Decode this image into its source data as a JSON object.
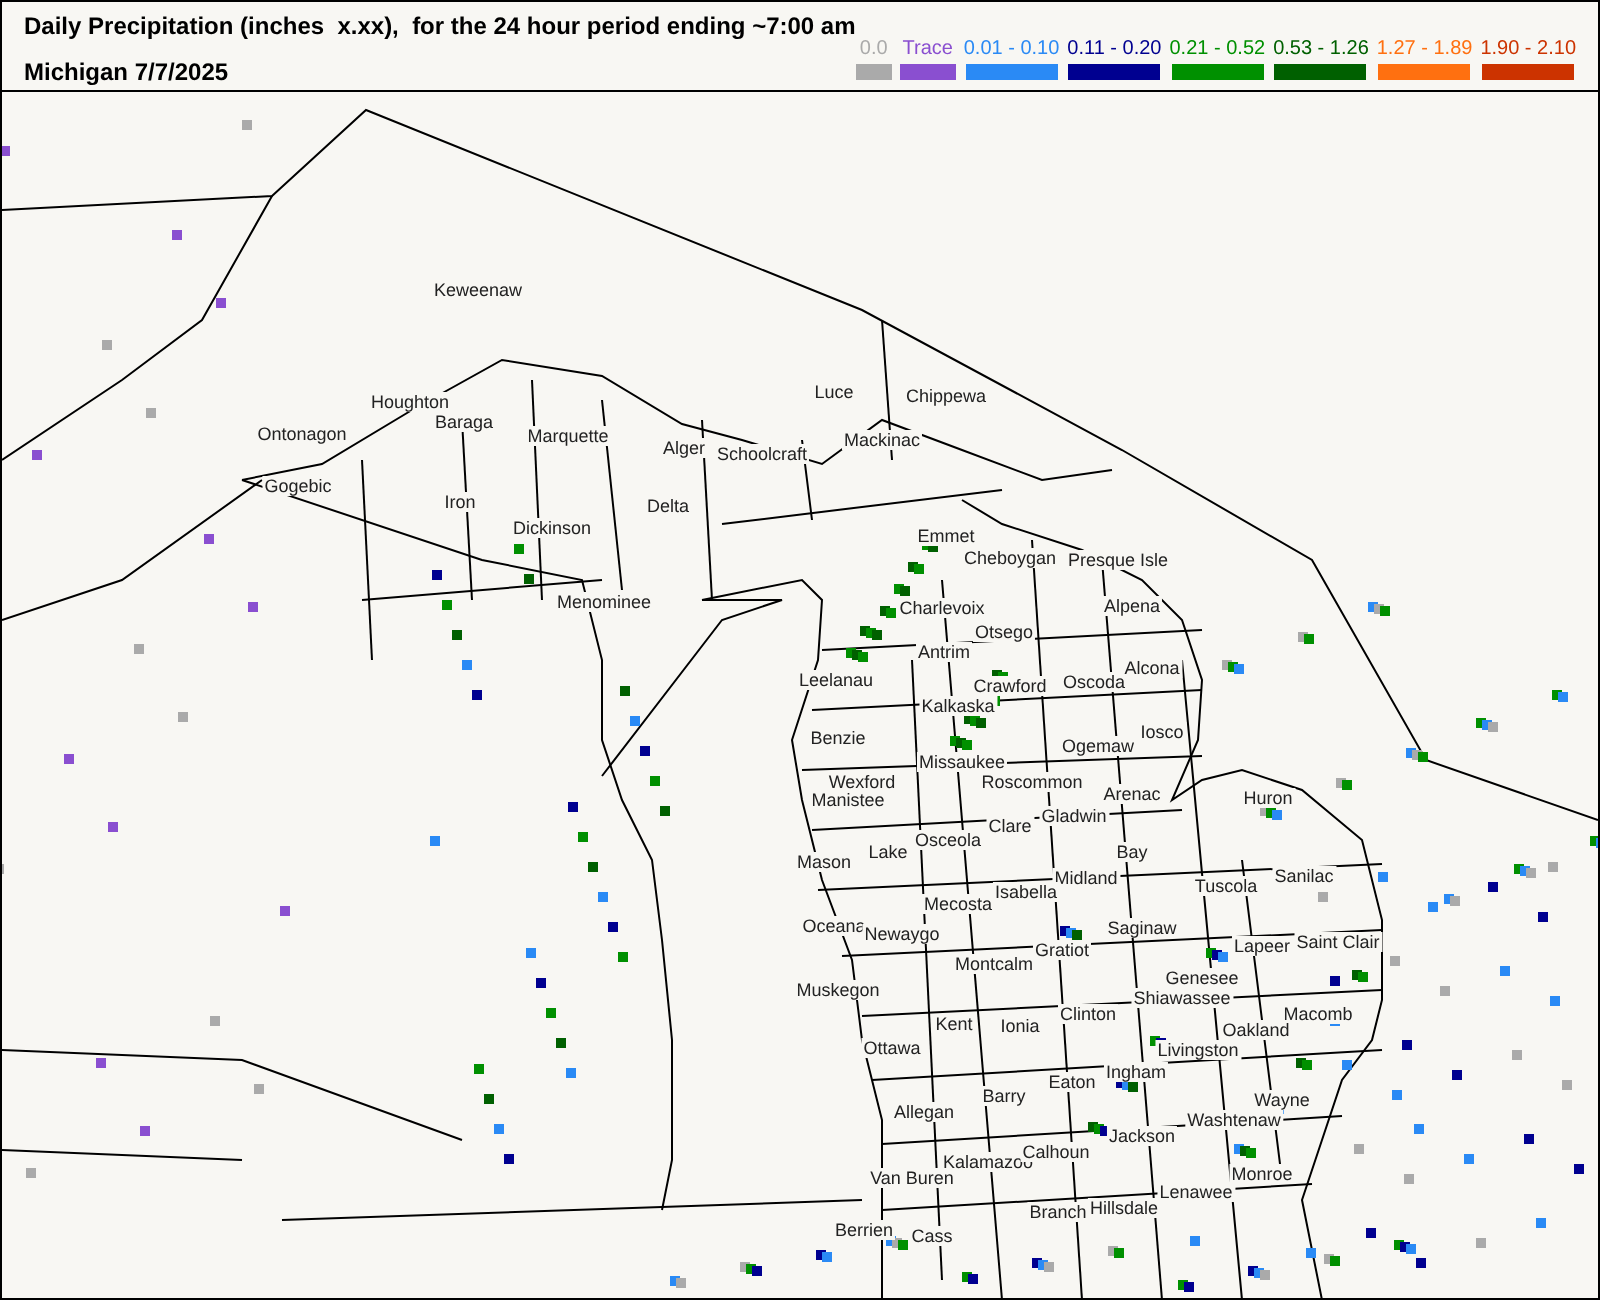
{
  "header": {
    "title": "Daily Precipitation (inches  x.xx),  for the 24 hour period ending ~7:00 am",
    "subtitle": "Michigan 7/7/2025"
  },
  "legend": [
    {
      "label": "0.0",
      "color": "#aaaaaa"
    },
    {
      "label": "Trace",
      "color": "#8a4fd0"
    },
    {
      "label": "0.01 - 0.10",
      "color": "#2a8af5"
    },
    {
      "label": "0.11 - 0.20",
      "color": "#000090"
    },
    {
      "label": "0.21 - 0.52",
      "color": "#009000"
    },
    {
      "label": "0.53 - 1.26",
      "color": "#006000"
    },
    {
      "label": "1.27 - 1.89",
      "color": "#ff7010"
    },
    {
      "label": "1.90 - 2.10",
      "color": "#cc3300"
    }
  ],
  "map": {
    "counties": [
      "Keweenaw",
      "Houghton",
      "Ontonagon",
      "Baraga",
      "Marquette",
      "Gogebic",
      "Iron",
      "Dickinson",
      "Alger",
      "Schoolcraft",
      "Luce",
      "Chippewa",
      "Mackinac",
      "Delta",
      "Menominee",
      "Emmet",
      "Cheboygan",
      "Presque Isle",
      "Charlevoix",
      "Otsego",
      "Alpena",
      "Antrim",
      "Leelanau",
      "Kalkaska",
      "Crawford",
      "Oscoda",
      "Alcona",
      "Benzie",
      "Iosco",
      "Ogemaw",
      "Wexford",
      "Missaukee",
      "Roscommon",
      "Manistee",
      "Arenac",
      "Clare",
      "Gladwin",
      "Huron",
      "Mason",
      "Lake",
      "Osceola",
      "Bay",
      "Midland",
      "Isabella",
      "Tuscola",
      "Sanilac",
      "Mecosta",
      "Oceana",
      "Newaygo",
      "Saginaw",
      "Gratiot",
      "Lapeer",
      "Saint Clair",
      "Montcalm",
      "Muskegon",
      "Genesee",
      "Shiawassee",
      "Kent",
      "Ionia",
      "Clinton",
      "Macomb",
      "Oakland",
      "Ottawa",
      "Livingston",
      "Allegan",
      "Barry",
      "Eaton",
      "Ingham",
      "Wayne",
      "Washtenaw",
      "Van Buren",
      "Kalamazoo",
      "Calhoun",
      "Jackson",
      "Monroe",
      "Lenawee",
      "Hillsdale",
      "Branch",
      "Berrien",
      "Cass"
    ]
  }
}
